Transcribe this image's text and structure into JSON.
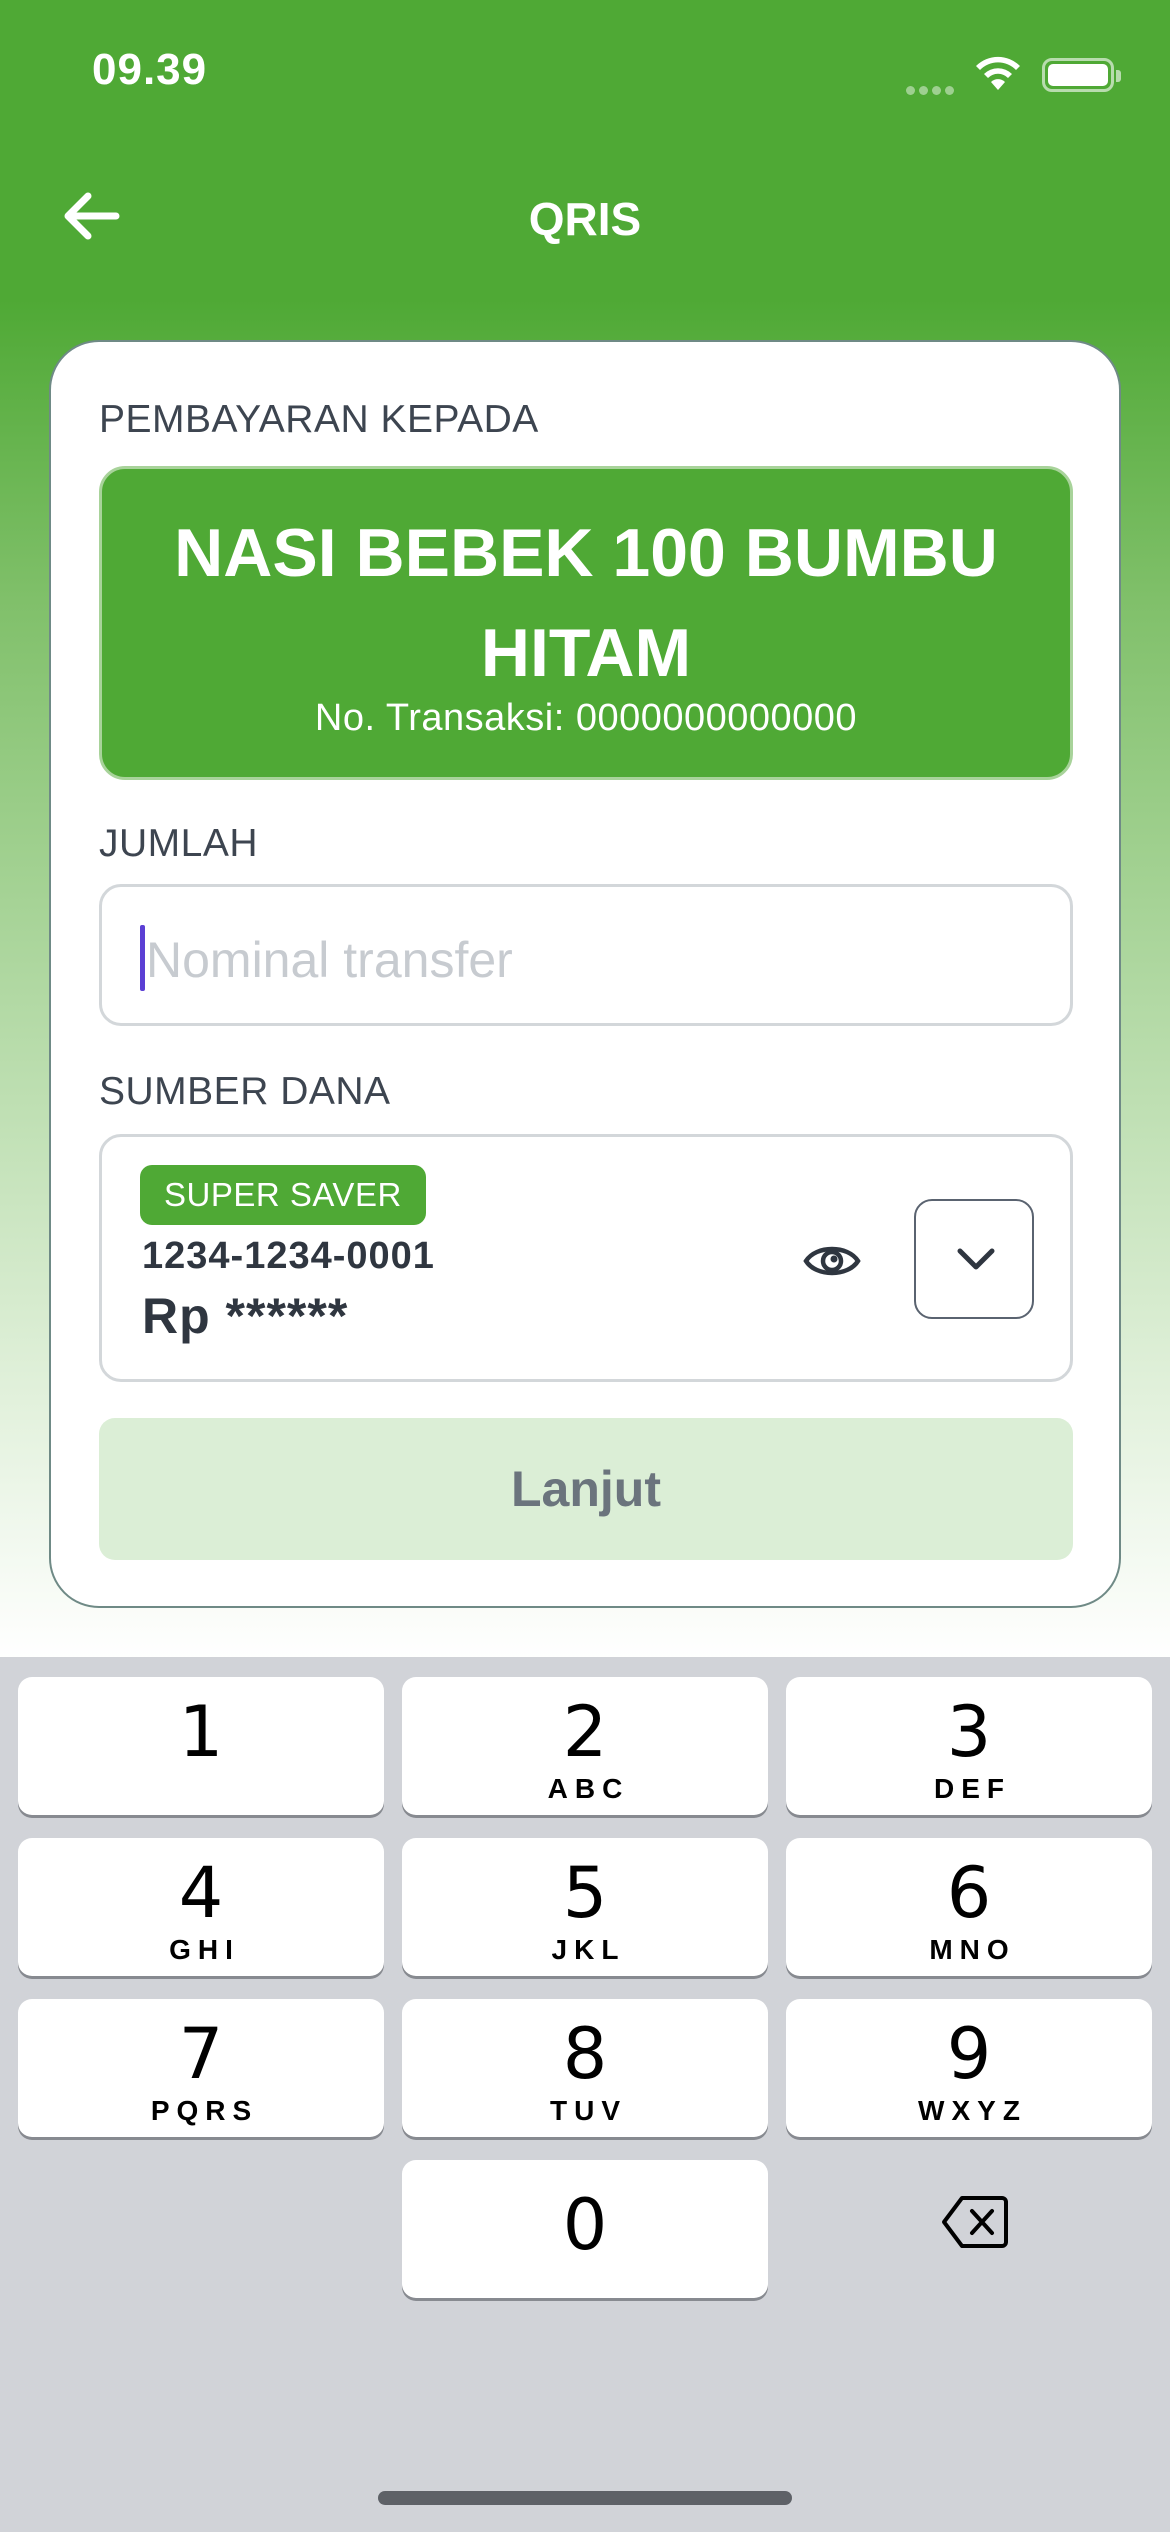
{
  "status_bar": {
    "time": "09.39"
  },
  "nav": {
    "title": "QRIS"
  },
  "payment": {
    "to_label": "PEMBAYARAN KEPADA",
    "merchant_name": "NASI BEBEK 100 BUMBU HITAM",
    "transaction": "No. Transaksi: 0000000000000"
  },
  "amount": {
    "label": "JUMLAH",
    "placeholder": "Nominal transfer",
    "value": ""
  },
  "source": {
    "label": "SUMBER DANA",
    "badge": "SUPER SAVER",
    "account_number": "1234-1234-0001",
    "balance": "Rp ******"
  },
  "continue_button": {
    "label": "Lanjut",
    "enabled": false
  },
  "keypad": {
    "keys": [
      {
        "num": "1",
        "letters": ""
      },
      {
        "num": "2",
        "letters": "ABC"
      },
      {
        "num": "3",
        "letters": "DEF"
      },
      {
        "num": "4",
        "letters": "GHI"
      },
      {
        "num": "5",
        "letters": "JKL"
      },
      {
        "num": "6",
        "letters": "MNO"
      },
      {
        "num": "7",
        "letters": "PQRS"
      },
      {
        "num": "8",
        "letters": "TUV"
      },
      {
        "num": "9",
        "letters": "WXYZ"
      },
      {
        "num": "0",
        "letters": ""
      }
    ]
  },
  "colors": {
    "brand_green": "#4fa935",
    "disabled_button": "#dbeed6",
    "caret": "#5b3fd4"
  }
}
